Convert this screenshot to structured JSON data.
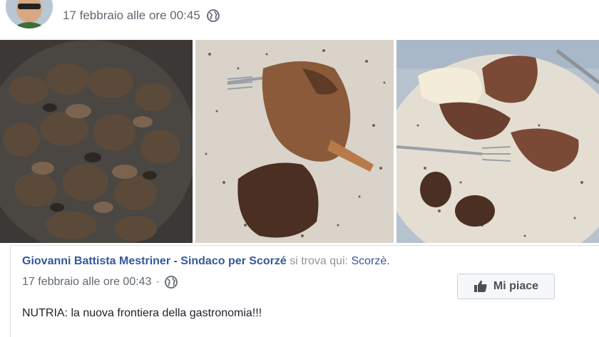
{
  "header": {
    "timestamp": "17 febbraio alle ore 00:45",
    "privacy_icon": "globe-icon"
  },
  "photos": [
    {
      "name": "photo-stewed-meat-pan",
      "description_icon": "photo"
    },
    {
      "name": "photo-plate-leg-fork",
      "description_icon": "photo"
    },
    {
      "name": "photo-plate-puree-fork",
      "description_icon": "photo"
    }
  ],
  "shared_post": {
    "page_name": "Giovanni Battista Mestriner - Sindaco per Scorzé",
    "checkin_label": "si trova qui:",
    "place": "Scorzè.",
    "timestamp": "17 febbraio alle ore 00:43",
    "separator": "·",
    "privacy_icon": "globe-icon",
    "like_label": "Mi piace",
    "text": "NUTRIA: la nuova frontiera della gastronomia!!!"
  },
  "colors": {
    "link": "#365899",
    "meta": "#606770",
    "text": "#1d2129",
    "button_bg": "#f6f7f9",
    "button_border": "#ccd0d5"
  }
}
